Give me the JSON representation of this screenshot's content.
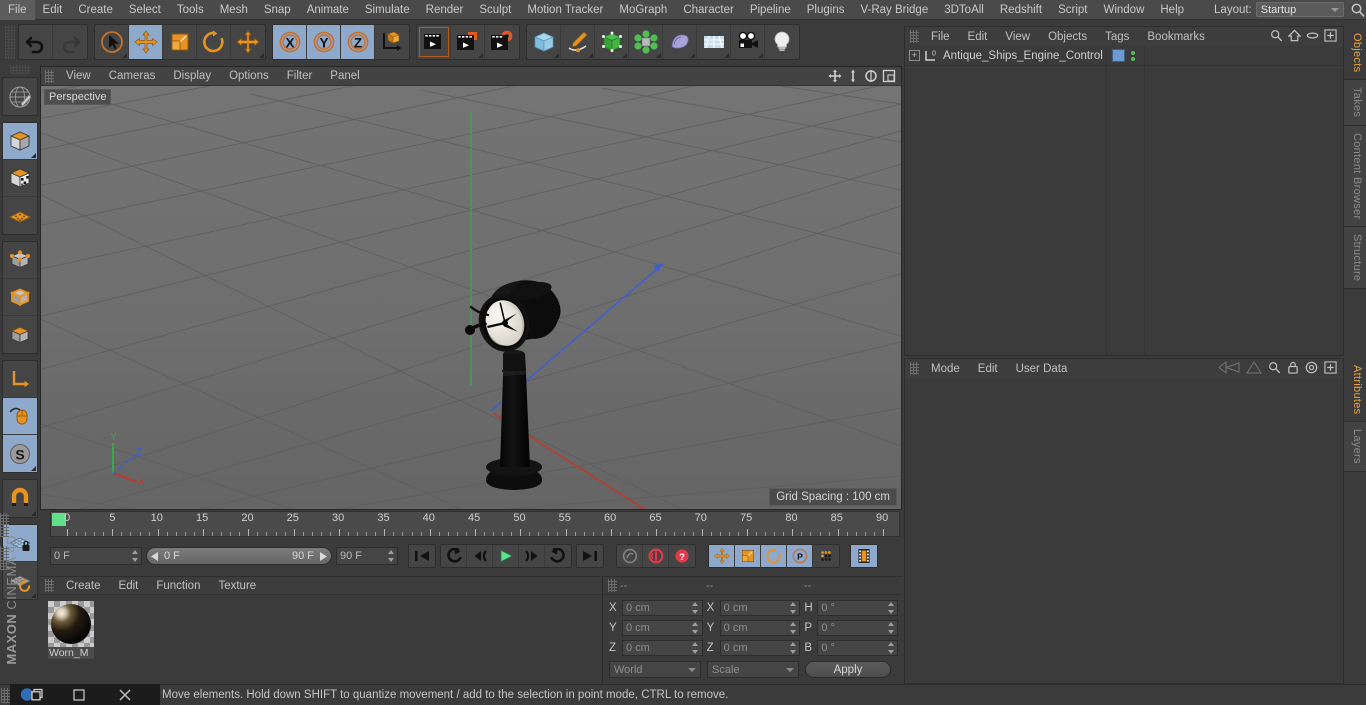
{
  "app": {
    "title": "MAXON CINEMA 4D",
    "brand_top": "MAXON",
    "brand_bottom": "CINEMA 4D"
  },
  "menubar": {
    "items": [
      {
        "label": "File"
      },
      {
        "label": "Edit"
      },
      {
        "label": "Create"
      },
      {
        "label": "Select"
      },
      {
        "label": "Tools"
      },
      {
        "label": "Mesh"
      },
      {
        "label": "Snap"
      },
      {
        "label": "Animate"
      },
      {
        "label": "Simulate"
      },
      {
        "label": "Render"
      },
      {
        "label": "Sculpt"
      },
      {
        "label": "Motion Tracker"
      },
      {
        "label": "MoGraph"
      },
      {
        "label": "Character"
      },
      {
        "label": "Pipeline"
      },
      {
        "label": "Plugins"
      },
      {
        "label": "V-Ray Bridge"
      },
      {
        "label": "3DToAll"
      },
      {
        "label": "Redshift"
      },
      {
        "label": "Script"
      },
      {
        "label": "Window"
      },
      {
        "label": "Help"
      }
    ],
    "layout_label": "Layout:",
    "layout_value": "Startup",
    "search_icon": "search-icon"
  },
  "toolbar": {
    "groups": [
      {
        "name": "history",
        "buttons": [
          {
            "name": "undo-button",
            "icon": "undo-arrow-icon",
            "active": false,
            "enabled": true
          },
          {
            "name": "redo-button",
            "icon": "redo-arrow-icon",
            "active": false,
            "enabled": false
          }
        ]
      },
      {
        "name": "transform-tools",
        "buttons": [
          {
            "name": "live-selection-tool",
            "icon": "cursor-circle-icon",
            "active": false,
            "corner": true
          },
          {
            "name": "move-tool",
            "icon": "move-arrows-icon",
            "active": true,
            "corner": false
          },
          {
            "name": "scale-tool",
            "icon": "scale-box-icon",
            "active": false,
            "corner": false
          },
          {
            "name": "rotate-tool",
            "icon": "rotate-circle-icon",
            "active": false,
            "corner": false
          },
          {
            "name": "dynamic-place-tool",
            "icon": "move-arrows-icon",
            "active": false,
            "corner": true
          }
        ]
      },
      {
        "name": "axis-locks",
        "buttons": [
          {
            "name": "x-axis-lock",
            "icon": "x-axis-icon",
            "active": true,
            "corner": false
          },
          {
            "name": "y-axis-lock",
            "icon": "y-axis-icon",
            "active": true,
            "corner": false
          },
          {
            "name": "z-axis-lock",
            "icon": "z-axis-icon",
            "active": true,
            "corner": false
          },
          {
            "name": "world-object-axis-toggle",
            "icon": "world-axis-cube-icon",
            "active": false,
            "corner": false
          }
        ]
      },
      {
        "name": "render-tools",
        "buttons": [
          {
            "name": "render-view-button",
            "icon": "clapperboard-icon",
            "active": false,
            "corner": false,
            "selected": true
          },
          {
            "name": "render-to-picture-viewer-button",
            "icon": "clapperboard-save-icon",
            "active": false,
            "corner": true
          },
          {
            "name": "render-settings-button",
            "icon": "clapperboard-gear-icon",
            "active": false,
            "corner": false
          }
        ]
      },
      {
        "name": "create-objects",
        "buttons": [
          {
            "name": "add-cube-button",
            "icon": "blue-cube-icon",
            "active": false,
            "corner": true
          },
          {
            "name": "add-spline-button",
            "icon": "pen-spline-icon",
            "active": false,
            "corner": true
          },
          {
            "name": "add-nurbs-button",
            "icon": "green-cube-cage-icon",
            "active": false,
            "corner": true
          },
          {
            "name": "add-array-button",
            "icon": "green-cluster-icon",
            "active": false,
            "corner": true
          },
          {
            "name": "add-deformer-button",
            "icon": "bend-deformer-icon",
            "active": false,
            "corner": true
          },
          {
            "name": "add-scene-object-button",
            "icon": "floor-grid-icon",
            "active": false,
            "corner": true
          },
          {
            "name": "add-camera-button",
            "icon": "camera-icon",
            "active": false,
            "corner": true
          },
          {
            "name": "add-light-button",
            "icon": "lightbulb-icon",
            "active": false,
            "corner": false
          }
        ]
      }
    ]
  },
  "leftbar": {
    "buttons": [
      {
        "name": "make-editable-tool",
        "icon": "globe-wireframe-icon",
        "active": false,
        "corner": false
      },
      {
        "name": "model-mode",
        "icon": "model-cube-icon",
        "active": true,
        "corner": true
      },
      {
        "name": "texture-mode",
        "icon": "texture-cube-icon",
        "active": false,
        "corner": false
      },
      {
        "name": "workplane-mode",
        "icon": "workplane-grid-icon",
        "active": false,
        "corner": false
      },
      {
        "name": "points-mode",
        "icon": "points-cube-icon",
        "active": false,
        "corner": false
      },
      {
        "name": "edges-mode",
        "icon": "edges-cube-icon",
        "active": false,
        "corner": false
      },
      {
        "name": "polygons-mode",
        "icon": "polygons-cube-icon",
        "active": false,
        "corner": false
      },
      {
        "name": "enable-axis-modification",
        "icon": "axis-L-icon",
        "active": false,
        "corner": false
      },
      {
        "name": "viewport-solo-single",
        "icon": "mouse-spline-icon",
        "active": true,
        "corner": false
      },
      {
        "name": "enable-snapping",
        "icon": "snap-S-icon",
        "active": true,
        "corner": true
      },
      {
        "name": "magnet-tool",
        "icon": "magnet-icon",
        "active": false,
        "corner": true
      },
      {
        "name": "lock-workplane",
        "icon": "grid-lock-icon",
        "active": true,
        "corner": false
      },
      {
        "name": "workplane-align",
        "icon": "grid-rotate-icon",
        "active": false,
        "corner": true
      }
    ]
  },
  "viewport": {
    "menus": [
      {
        "label": "View"
      },
      {
        "label": "Cameras"
      },
      {
        "label": "Display"
      },
      {
        "label": "Options"
      },
      {
        "label": "Filter"
      },
      {
        "label": "Panel"
      }
    ],
    "nav_icons": [
      {
        "name": "pan-view-icon"
      },
      {
        "name": "zoom-view-icon"
      },
      {
        "name": "rotate-view-icon"
      },
      {
        "name": "maximize-view-icon"
      }
    ],
    "label": "Perspective",
    "grid_spacing": "Grid Spacing : 100 cm",
    "axis_gizmo": {
      "x": "X",
      "y": "Y",
      "z": "Z"
    },
    "colors": {
      "bg": "#6d6d6d",
      "grid_line": "#5f5f5f",
      "axis_x": "#c0392b",
      "axis_y": "#3fa34d",
      "axis_z": "#3f5fd0"
    },
    "scene_object": "Antique ships engine order telegraph"
  },
  "timeline": {
    "ticks": [
      0,
      5,
      10,
      15,
      20,
      25,
      30,
      35,
      40,
      45,
      50,
      55,
      60,
      65,
      70,
      75,
      80,
      85,
      90
    ],
    "current_frame": "0 F",
    "range_start": "0 F",
    "range_end": "90 F",
    "end_frame": "90 F",
    "preview_frame": "0 F",
    "playhead_frame": 0,
    "transport": [
      {
        "name": "go-to-start-button",
        "icon": "skip-start-icon",
        "active": false
      },
      {
        "name": "previous-key-button",
        "icon": "prev-key-icon",
        "active": false
      },
      {
        "name": "step-back-button",
        "icon": "step-back-icon",
        "active": false
      },
      {
        "name": "play-button",
        "icon": "play-icon",
        "active": false
      },
      {
        "name": "step-forward-button",
        "icon": "step-forward-icon",
        "active": false
      },
      {
        "name": "next-key-button",
        "icon": "next-key-icon",
        "active": false
      },
      {
        "name": "go-to-end-button",
        "icon": "skip-end-icon",
        "active": false
      }
    ],
    "record_tools": [
      {
        "name": "record-active-objects-button",
        "icon": "record-key-icon",
        "active": false,
        "enabled": false
      },
      {
        "name": "autokeying-button",
        "icon": "autokey-record-icon",
        "active": false,
        "enabled": true
      },
      {
        "name": "keyframe-selection-button",
        "icon": "keyframe-question-icon",
        "active": false,
        "enabled": true
      }
    ],
    "key_tools": [
      {
        "name": "key-position-toggle",
        "icon": "move-arrows-icon",
        "active": true
      },
      {
        "name": "key-scale-toggle",
        "icon": "scale-box-icon",
        "active": true
      },
      {
        "name": "key-rotation-toggle",
        "icon": "rotate-circle-icon",
        "active": true
      },
      {
        "name": "key-param-toggle",
        "icon": "param-p-icon",
        "active": true
      },
      {
        "name": "key-pla-toggle",
        "icon": "point-level-anim-icon",
        "active": false
      }
    ],
    "extra_tools": [
      {
        "name": "timeline-view-button",
        "icon": "filmstrip-icon",
        "active": true
      }
    ]
  },
  "material_manager": {
    "menus": [
      {
        "label": "Create"
      },
      {
        "label": "Edit"
      },
      {
        "label": "Function"
      },
      {
        "label": "Texture"
      }
    ],
    "materials": [
      {
        "name": "Worn_M",
        "icon": "material-sphere-preview"
      }
    ]
  },
  "coordinates": {
    "header_dashes": [
      "--",
      "--",
      "--"
    ],
    "rows": [
      {
        "pos_label": "X",
        "pos_value": "0 cm",
        "size_label": "X",
        "size_value": "0 cm",
        "rot_label": "H",
        "rot_value": "0 °"
      },
      {
        "pos_label": "Y",
        "pos_value": "0 cm",
        "size_label": "Y",
        "size_value": "0 cm",
        "rot_label": "P",
        "rot_value": "0 °"
      },
      {
        "pos_label": "Z",
        "pos_value": "0 cm",
        "size_label": "Z",
        "size_value": "0 cm",
        "rot_label": "B",
        "rot_value": "0 °"
      }
    ],
    "system_value": "World",
    "mode_value": "Scale",
    "apply_label": "Apply"
  },
  "object_manager": {
    "menus": [
      {
        "label": "File"
      },
      {
        "label": "Edit"
      },
      {
        "label": "View"
      },
      {
        "label": "Objects"
      },
      {
        "label": "Tags"
      },
      {
        "label": "Bookmarks"
      }
    ],
    "icons": [
      {
        "name": "search-icon"
      },
      {
        "name": "home-icon"
      },
      {
        "name": "ellipse-icon"
      },
      {
        "name": "add-panel-icon"
      }
    ],
    "rows": [
      {
        "label": "Antique_Ships_Engine_Control",
        "icon": "null-object-icon",
        "expandable": true,
        "tag_color": "#6b9bd2",
        "visibility_dots": 2
      }
    ]
  },
  "attribute_manager": {
    "menus": [
      {
        "label": "Mode"
      },
      {
        "label": "Edit"
      },
      {
        "label": "User Data"
      }
    ],
    "icons": [
      {
        "name": "history-back-icon"
      },
      {
        "name": "history-forward-icon"
      },
      {
        "name": "search-icon"
      },
      {
        "name": "lock-icon"
      },
      {
        "name": "target-icon"
      },
      {
        "name": "add-panel-icon"
      }
    ]
  },
  "right_tabs_top": [
    {
      "label": "Objects",
      "active": true
    },
    {
      "label": "Takes",
      "active": false
    },
    {
      "label": "Content Browser",
      "active": false
    },
    {
      "label": "Structure",
      "active": false
    }
  ],
  "right_tabs_bottom": [
    {
      "label": "Attributes",
      "active": true
    },
    {
      "label": "Layers",
      "active": false
    }
  ],
  "statusbar": {
    "text": "Move elements. Hold down SHIFT to quantize movement / add to the selection in point mode, CTRL to remove."
  },
  "taskbar": {
    "buttons": [
      {
        "name": "app-icon-button",
        "icon": "cinema4d-logo-icon"
      },
      {
        "name": "restore-window-button",
        "icon": "restore-square-icon"
      },
      {
        "name": "close-window-button",
        "icon": "close-x-icon"
      }
    ]
  }
}
